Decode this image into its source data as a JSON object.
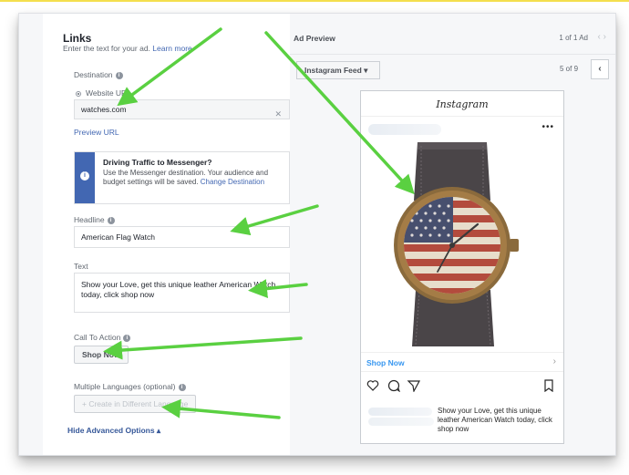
{
  "form": {
    "section_title": "Links",
    "section_sub": "Enter the text for your ad.",
    "learn_more": "Learn more.",
    "destination_label": "Destination",
    "website_url_label": "Website URL",
    "website_url_value": "watches.com",
    "preview_url": "Preview URL",
    "notice_title": "Driving Traffic to Messenger?",
    "notice_body": "Use the Messenger destination. Your audience and budget settings will be saved.",
    "notice_link": "Change Destination",
    "headline_label": "Headline",
    "headline_value": "American Flag Watch",
    "text_label": "Text",
    "text_value": "Show your Love, get this unique leather American Watch today, click shop now",
    "cta_label": "Call To Action",
    "cta_value": "Shop Now",
    "languages_label": "Multiple Languages (optional)",
    "languages_button": "+ Create in Different Language",
    "hide_advanced": "Hide Advanced Options ▴"
  },
  "preview": {
    "title": "Ad Preview",
    "count": "1 of 1 Ad",
    "placement": "Instagram Feed ▾",
    "page_of": "5 of 9",
    "ig_logo": "Instagram",
    "cta": "Shop Now",
    "caption": "Show your Love, get this unique leather American Watch today, click shop now"
  },
  "colors": {
    "accent": "#4267b2",
    "arrow": "#5ad041",
    "ig_link": "#3897f0"
  }
}
